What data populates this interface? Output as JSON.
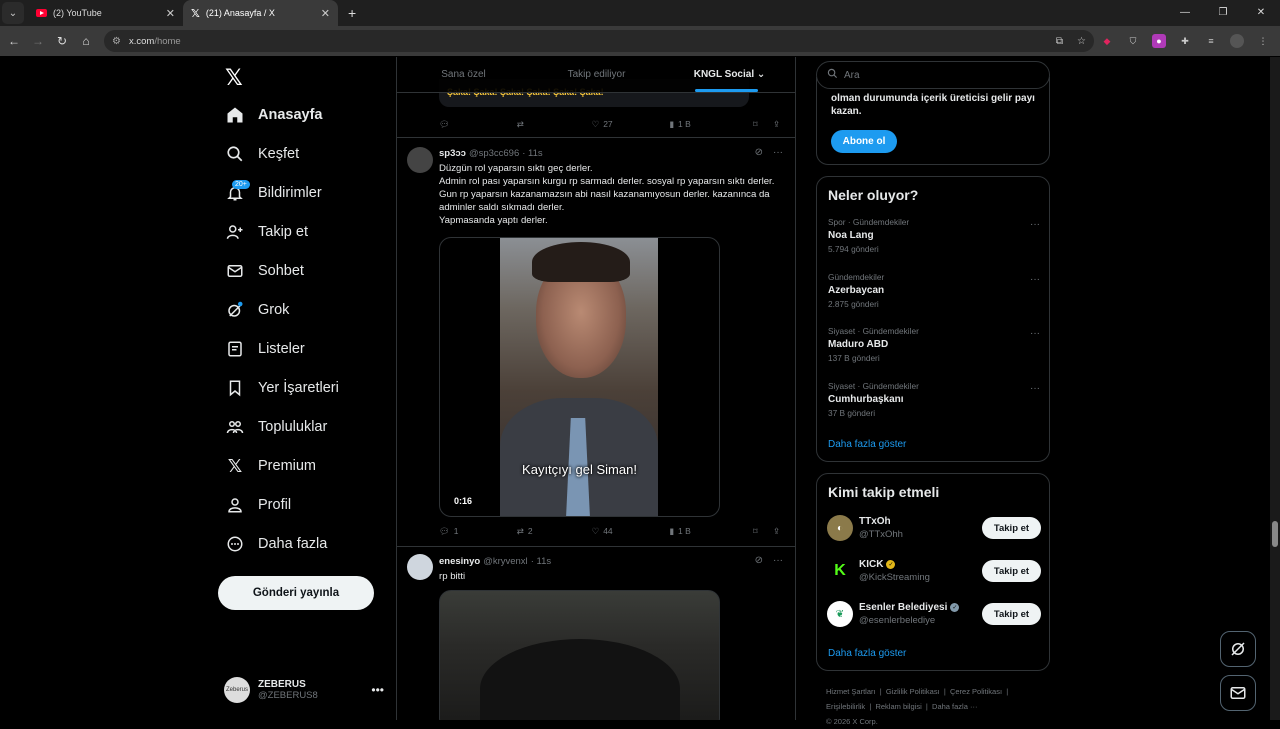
{
  "browser": {
    "tabs": [
      {
        "title": "(2) YouTube"
      },
      {
        "title": "(21) Anasayfa / X"
      }
    ],
    "url_host": "x.com",
    "url_path": "/home"
  },
  "nav": {
    "items": [
      {
        "label": "Anasayfa"
      },
      {
        "label": "Keşfet"
      },
      {
        "label": "Bildirimler",
        "badge": "20+"
      },
      {
        "label": "Takip et"
      },
      {
        "label": "Sohbet"
      },
      {
        "label": "Grok"
      },
      {
        "label": "Listeler"
      },
      {
        "label": "Yer İşaretleri"
      },
      {
        "label": "Topluluklar"
      },
      {
        "label": "Premium"
      },
      {
        "label": "Profil"
      },
      {
        "label": "Daha fazla"
      }
    ],
    "post_button": "Gönderi yayınla",
    "account": {
      "name": "ZEBERUS",
      "handle": "@ZEBERUS8",
      "avatar_text": "Zeberus"
    }
  },
  "feed": {
    "tabs": [
      {
        "label": "Sana özel"
      },
      {
        "label": "Takip ediliyor"
      },
      {
        "label": "KNGL Social"
      }
    ],
    "prev_card_text": "Şaka! Şaka! Şaka! Şaka! Şaka! Şaka!",
    "prev_stats": {
      "replies": "",
      "reposts": "",
      "likes": "27",
      "views": "1 B"
    },
    "posts": [
      {
        "name": "sp3ɔɔ",
        "handle": "@sp3cc696",
        "time": "· 11s",
        "text": "Düzgün rol yaparsın sıktı geç derler.\nAdmin rol pası yaparsın kurgu rp sarmadı derler. sosyal rp yaparsın sıktı derler. Gun rp yaparsın kazanamazsın abi nasıl kazanamıyosun derler. kazanınca da adminler saldı sıkmadı derler.\nYapmasanda yaptı derler.",
        "video_caption": "Kayıtçıyı gel Siman!",
        "video_time": "0:16",
        "stats": {
          "replies": "1",
          "reposts": "2",
          "likes": "44",
          "views": "1 B"
        }
      },
      {
        "name": "enesinyo",
        "handle": "@kryvenxl",
        "time": "· 11s",
        "text": "rp bitti"
      }
    ]
  },
  "right": {
    "search_placeholder": "Ara",
    "premium_text": "olman durumunda içerik üreticisi gelir payı kazan.",
    "subscribe_button": "Abone ol",
    "trends_title": "Neler oluyor?",
    "trends": [
      {
        "category": "Spor · Gündemdekiler",
        "title": "Noa Lang",
        "count": "5.794 gönderi"
      },
      {
        "category": "Gündemdekiler",
        "title": "Azerbaycan",
        "count": "2.875 gönderi"
      },
      {
        "category": "Siyaset · Gündemdekiler",
        "title": "Maduro ABD",
        "count": "137 B gönderi"
      },
      {
        "category": "Siyaset · Gündemdekiler",
        "title": "Cumhurbaşkanı",
        "count": "37 B gönderi"
      }
    ],
    "show_more": "Daha fazla göster",
    "who_title": "Kimi takip etmeli",
    "who": [
      {
        "name": "TTxOh",
        "handle": "@TTxOhh",
        "button": "Takip et",
        "verified": ""
      },
      {
        "name": "KICK",
        "handle": "@KickStreaming",
        "button": "Takip et",
        "verified": "gold"
      },
      {
        "name": "Esenler Belediyesi",
        "handle": "@esenlerbelediye",
        "button": "Takip et",
        "verified": "gray"
      }
    ],
    "who_show_more": "Daha fazla göster",
    "footer": [
      "Hizmet Şartları",
      "Gizlilik Politikası",
      "Çerez Politikası",
      "Erişilebilirlik",
      "Reklam bilgisi",
      "Daha fazla ···",
      "© 2026 X Corp."
    ]
  },
  "colors": {
    "accent": "#1d9bf0",
    "background": "#000000",
    "border": "#2f3336",
    "muted": "#71767b"
  }
}
